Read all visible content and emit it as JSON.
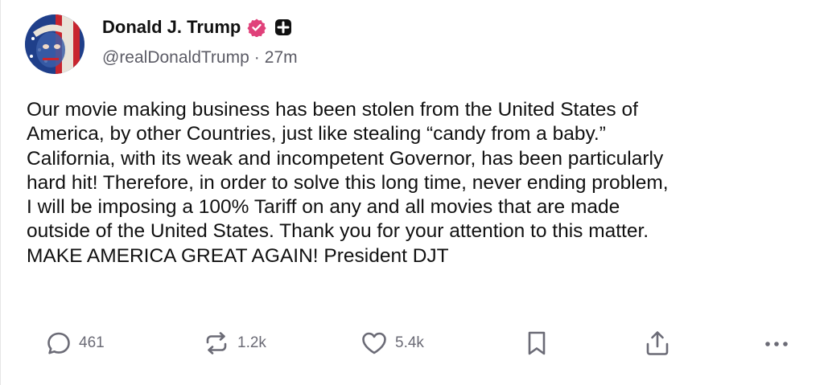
{
  "author": {
    "display_name": "Donald J. Trump",
    "handle": "@realDonaldTrump",
    "separator": "·",
    "timestamp": "27m",
    "verified_icon": "verified-badge-icon",
    "subscription_icon": "plus-badge-icon"
  },
  "post": {
    "text": "Our movie making business has been stolen from the United States of\nAmerica, by other Countries, just like stealing “candy from a baby.”\nCalifornia, with its weak and incompetent Governor, has been particularly\nhard hit! Therefore, in order to solve this long time, never ending problem,\nI will be imposing a 100% Tariff on any and all movies that are made\noutside of the United States. Thank you for your attention to this matter.\nMAKE AMERICA GREAT AGAIN! President DJT"
  },
  "actions": {
    "replies": "461",
    "reposts": "1.2k",
    "likes": "5.4k"
  },
  "colors": {
    "verified_badge": "#e0417a",
    "icon_gray": "#6b6b76",
    "text": "#111111",
    "meta": "#5c5c66"
  }
}
